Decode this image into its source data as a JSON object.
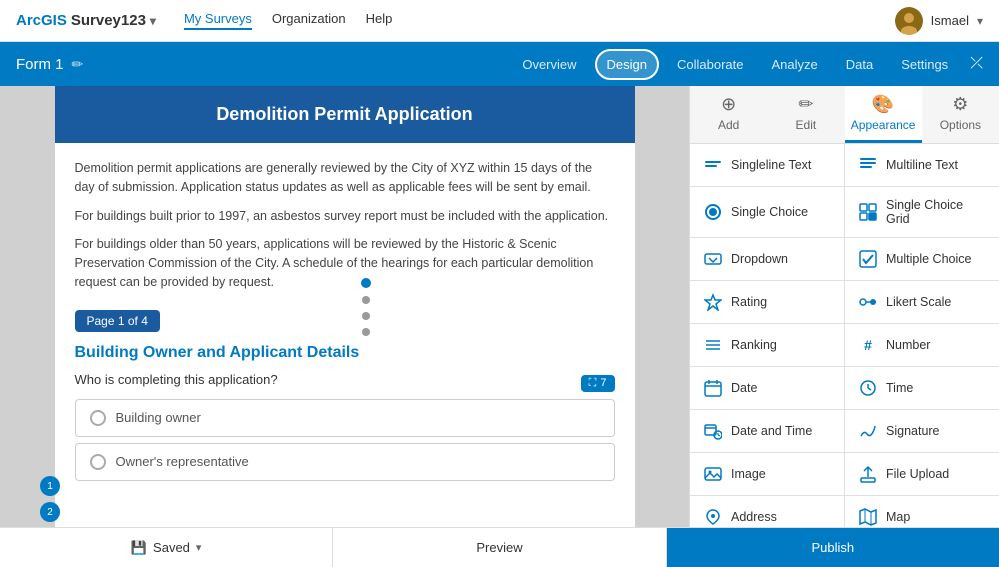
{
  "app": {
    "name": "ArcGIS Survey123",
    "nav": [
      {
        "label": "My Surveys",
        "active": true
      },
      {
        "label": "Organization",
        "active": false
      },
      {
        "label": "Help",
        "active": false
      }
    ],
    "user": "Ismael"
  },
  "formHeader": {
    "title": "Form 1",
    "navItems": [
      {
        "label": "Overview",
        "active": false
      },
      {
        "label": "Design",
        "active": true
      },
      {
        "label": "Collaborate",
        "active": false
      },
      {
        "label": "Analyze",
        "active": false
      },
      {
        "label": "Data",
        "active": false
      },
      {
        "label": "Settings",
        "active": false
      }
    ]
  },
  "survey": {
    "title": "Demolition Permit Application",
    "description1": "Demolition permit applications are generally reviewed by the City of XYZ within 15 days of the day of submission. Application status updates as well as applicable fees will be sent by email.",
    "description2": "For buildings built prior to 1997, an asbestos survey report must be included with the application.",
    "description3": "For buildings older than 50 years, applications will be reviewed by the Historic & Scenic Preservation Commission of the City. A schedule of the hearings for each particular demolition request can be provided by request.",
    "pageIndicator": "Page 1 of 4",
    "sectionTitle": "Building Owner and Applicant Details",
    "question1": {
      "text": "Who is completing this application?",
      "badge": "7",
      "options": [
        {
          "label": "Building owner"
        },
        {
          "label": "Owner's representative"
        }
      ]
    }
  },
  "rightPanel": {
    "tabs": [
      {
        "label": "Add",
        "icon": "⊕",
        "active": false
      },
      {
        "label": "Edit",
        "icon": "✏️",
        "active": false
      },
      {
        "label": "Appearance",
        "icon": "🎨",
        "active": true
      },
      {
        "label": "Options",
        "icon": "⚙",
        "active": false
      }
    ],
    "tools": [
      {
        "label": "Singleline Text",
        "icon": "≡"
      },
      {
        "label": "Multiline Text",
        "icon": "≡≡"
      },
      {
        "label": "Single Choice",
        "icon": "◉"
      },
      {
        "label": "Single Choice Grid",
        "icon": "⊞"
      },
      {
        "label": "Dropdown",
        "icon": "▼"
      },
      {
        "label": "Multiple Choice",
        "icon": "☑"
      },
      {
        "label": "Rating",
        "icon": "★"
      },
      {
        "label": "Likert Scale",
        "icon": "⊙"
      },
      {
        "label": "Ranking",
        "icon": "≡"
      },
      {
        "label": "Number",
        "icon": "#"
      },
      {
        "label": "Date",
        "icon": "📅"
      },
      {
        "label": "Time",
        "icon": "🕐"
      },
      {
        "label": "Date and Time",
        "icon": "📅"
      },
      {
        "label": "Signature",
        "icon": "✍"
      },
      {
        "label": "Image",
        "icon": "🖼"
      },
      {
        "label": "File Upload",
        "icon": "⬆"
      },
      {
        "label": "Address",
        "icon": "📍"
      },
      {
        "label": "Map",
        "icon": "🗺"
      }
    ]
  },
  "bottomBar": {
    "saved": "Saved",
    "preview": "Preview",
    "publish": "Publish"
  }
}
